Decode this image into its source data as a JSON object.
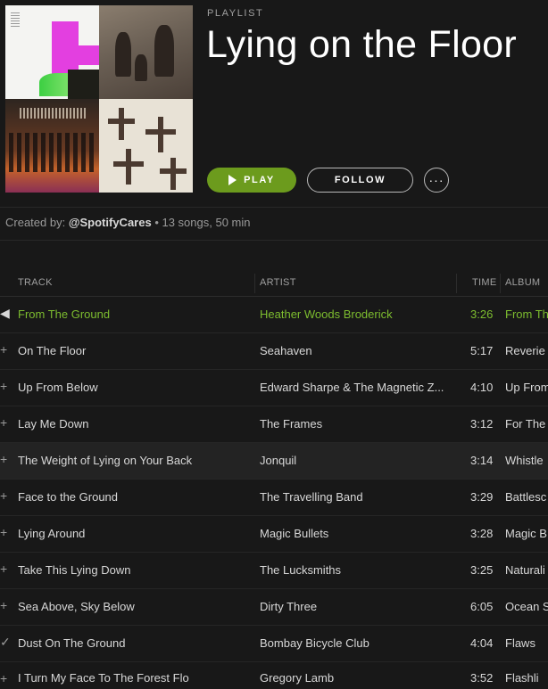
{
  "header": {
    "type_label": "PLAYLIST",
    "title": "Lying on the Floor",
    "play_label": "PLAY",
    "follow_label": "FOLLOW",
    "more_label": "···",
    "created_by_prefix": "Created by: ",
    "owner": "@SpotifyCares",
    "stats": " • 13 songs, 50 min"
  },
  "table": {
    "columns": {
      "track": "TRACK",
      "artist": "ARTIST",
      "time": "TIME",
      "album": "ALBUM"
    },
    "rows": [
      {
        "marker": "◀",
        "track": "From The Ground",
        "artist": "Heather Woods Broderick",
        "time": "3:26",
        "album": "From Th"
      },
      {
        "marker": "+",
        "track": "On The Floor",
        "artist": "Seahaven",
        "time": "5:17",
        "album": "Reverie"
      },
      {
        "marker": "+",
        "track": "Up From Below",
        "artist": "Edward Sharpe & The Magnetic Z...",
        "time": "4:10",
        "album": "Up From"
      },
      {
        "marker": "+",
        "track": "Lay Me Down",
        "artist": "The Frames",
        "time": "3:12",
        "album": "For The"
      },
      {
        "marker": "+",
        "track": "The Weight of Lying on Your Back",
        "artist": "Jonquil",
        "time": "3:14",
        "album": "Whistle"
      },
      {
        "marker": "+",
        "track": "Face to the Ground",
        "artist": "The Travelling Band",
        "time": "3:29",
        "album": "Battlesc"
      },
      {
        "marker": "+",
        "track": "Lying Around",
        "artist": "Magic Bullets",
        "time": "3:28",
        "album": "Magic B"
      },
      {
        "marker": "+",
        "track": "Take This Lying Down",
        "artist": "The Lucksmiths",
        "time": "3:25",
        "album": "Naturali"
      },
      {
        "marker": "+",
        "track": "Sea Above, Sky Below",
        "artist": "Dirty Three",
        "time": "6:05",
        "album": "Ocean S"
      },
      {
        "marker": "✓",
        "track": "Dust On The Ground",
        "artist": "Bombay Bicycle Club",
        "time": "4:04",
        "album": "Flaws"
      },
      {
        "marker": "+",
        "track": "I Turn My Face To The Forest Flo",
        "artist": "Gregory Lamb",
        "time": "3:52",
        "album": "Flashli"
      }
    ]
  },
  "colors": {
    "accent": "#7dbd2f",
    "play_button": "#6c9b1d",
    "background": "#181818"
  }
}
